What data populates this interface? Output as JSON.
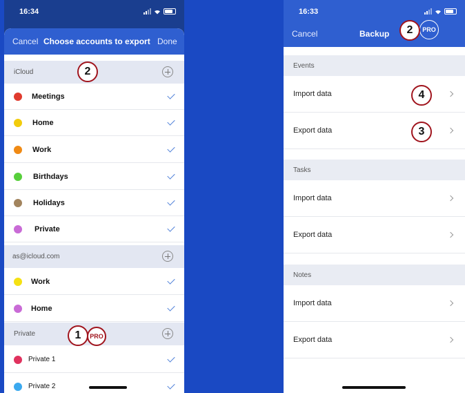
{
  "left": {
    "status_time": "16:34",
    "nav": {
      "cancel": "Cancel",
      "title": "Choose accounts to export",
      "done": "Done"
    },
    "sections": [
      {
        "label": "iCloud",
        "items": [
          {
            "label": "Meetings",
            "color": "#e03b2e"
          },
          {
            "label": "Home",
            "color": "#f2cc0c"
          },
          {
            "label": "Work",
            "color": "#f08a14"
          },
          {
            "label": "Birthdays",
            "color": "#57cf3b"
          },
          {
            "label": "Holidays",
            "color": "#a2845e"
          },
          {
            "label": "Private",
            "color": "#c96bd6"
          }
        ]
      },
      {
        "label": "as@icloud.com",
        "items": [
          {
            "label": "Work",
            "color": "#f5e112"
          },
          {
            "label": "Home",
            "color": "#c96bd6"
          }
        ]
      },
      {
        "label": "Private",
        "items": [
          {
            "label": "Private 1",
            "color": "#e0325e"
          },
          {
            "label": "Private 2",
            "color": "#3ba9ef"
          }
        ]
      }
    ],
    "annotations": {
      "two": "2",
      "one": "1",
      "pro": "PRO"
    }
  },
  "right": {
    "status_time": "16:33",
    "nav": {
      "cancel": "Cancel",
      "title": "Backup",
      "pro": "PRO"
    },
    "sections": [
      {
        "label": "Events",
        "rows": [
          "Import data",
          "Export data"
        ]
      },
      {
        "label": "Tasks",
        "rows": [
          "Import data",
          "Export data"
        ]
      },
      {
        "label": "Notes",
        "rows": [
          "Import data",
          "Export data"
        ]
      }
    ],
    "annotations": {
      "two": "2",
      "four": "4",
      "three": "3"
    }
  },
  "colors": {
    "background": "#1a49c3",
    "nav": "#2f5fd0",
    "annotation": "#a0141d",
    "check": "#4d7fd8"
  }
}
